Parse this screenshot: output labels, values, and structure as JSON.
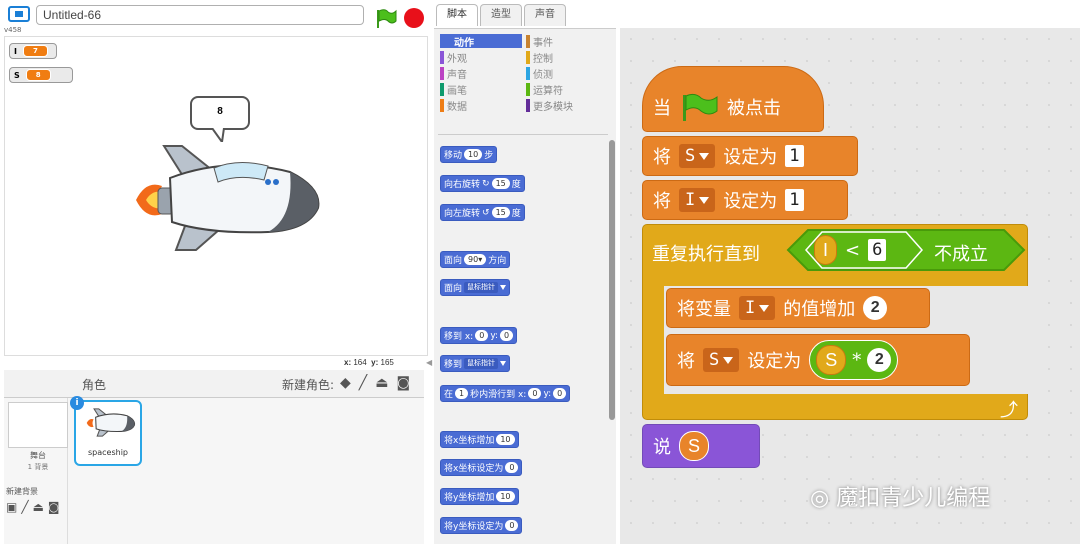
{
  "project": {
    "title": "Untitled-66",
    "version": "v458"
  },
  "monitors": [
    {
      "name": "I",
      "value": "7"
    },
    {
      "name": "S",
      "value": "8"
    }
  ],
  "stage": {
    "say_bubble": "8",
    "coord_x_label": "x:",
    "coord_x": "164",
    "coord_y_label": "y:",
    "coord_y": "165"
  },
  "sprites_pane": {
    "header": "角色",
    "new_sprite": "新建角色:",
    "stage_label": "舞台",
    "stage_backdrops": "1 背景",
    "new_backdrop": "新建背景",
    "sprite_name": "spaceship"
  },
  "tabs": [
    "脚本",
    "造型",
    "声音"
  ],
  "categories": [
    {
      "label": "动作",
      "color": "#4a6cd4",
      "selected": true
    },
    {
      "label": "事件",
      "color": "#c88330"
    },
    {
      "label": "外观",
      "color": "#8a55d7"
    },
    {
      "label": "控制",
      "color": "#e1a91a"
    },
    {
      "label": "声音",
      "color": "#bb42c3"
    },
    {
      "label": "侦测",
      "color": "#2ca5e2"
    },
    {
      "label": "画笔",
      "color": "#0e9a6c"
    },
    {
      "label": "运算符",
      "color": "#5cb712"
    },
    {
      "label": "数据",
      "color": "#ee7d16"
    },
    {
      "label": "更多模块",
      "color": "#632d99"
    }
  ],
  "palette": {
    "move": "移动",
    "move_steps": "10",
    "move_unit": "步",
    "turn_right": "向右旋转",
    "turn_right_deg": "15",
    "deg": "度",
    "turn_left": "向左旋转",
    "turn_left_deg": "15",
    "point_dir": "面向",
    "point_dir_val": "90▾",
    "point_dir_unit": "方向",
    "point_towards": "面向",
    "point_towards_val": "鼠标指针",
    "goto_xy": "移到 x:",
    "goto_x": "0",
    "goto_y_label": "y:",
    "goto_y": "0",
    "goto": "移到",
    "goto_val": "鼠标指针",
    "glide_pre": "在",
    "glide_secs": "1",
    "glide_mid": "秒内滑行到 x:",
    "glide_x": "0",
    "glide_y_label": "y:",
    "glide_y": "0",
    "change_x": "将x坐标增加",
    "change_x_val": "10",
    "set_x": "将x坐标设定为",
    "set_x_val": "0",
    "change_y": "将y坐标增加",
    "change_y_val": "10",
    "set_y": "将y坐标设定为",
    "set_y_val": "0"
  },
  "script": {
    "hat_when": "当",
    "hat_clicked": "被点击",
    "set1_pre": "将",
    "set1_var": "S",
    "set1_mid": "设定为",
    "set1_val": "1",
    "set2_pre": "将",
    "set2_var": "I",
    "set2_mid": "设定为",
    "set2_val": "1",
    "repeat_label": "重复执行直到",
    "cond_var": "I",
    "cond_op": "<",
    "cond_val": "6",
    "cond_not": "不成立",
    "inc_pre": "将变量",
    "inc_var": "I",
    "inc_mid": "的值增加",
    "inc_val": "2",
    "set3_pre": "将",
    "set3_var": "S",
    "set3_mid": "设定为",
    "set3_rep": "S",
    "set3_op": "*",
    "set3_val": "2",
    "say": "说",
    "say_var": "S"
  },
  "watermark": "魔扣青少儿编程"
}
